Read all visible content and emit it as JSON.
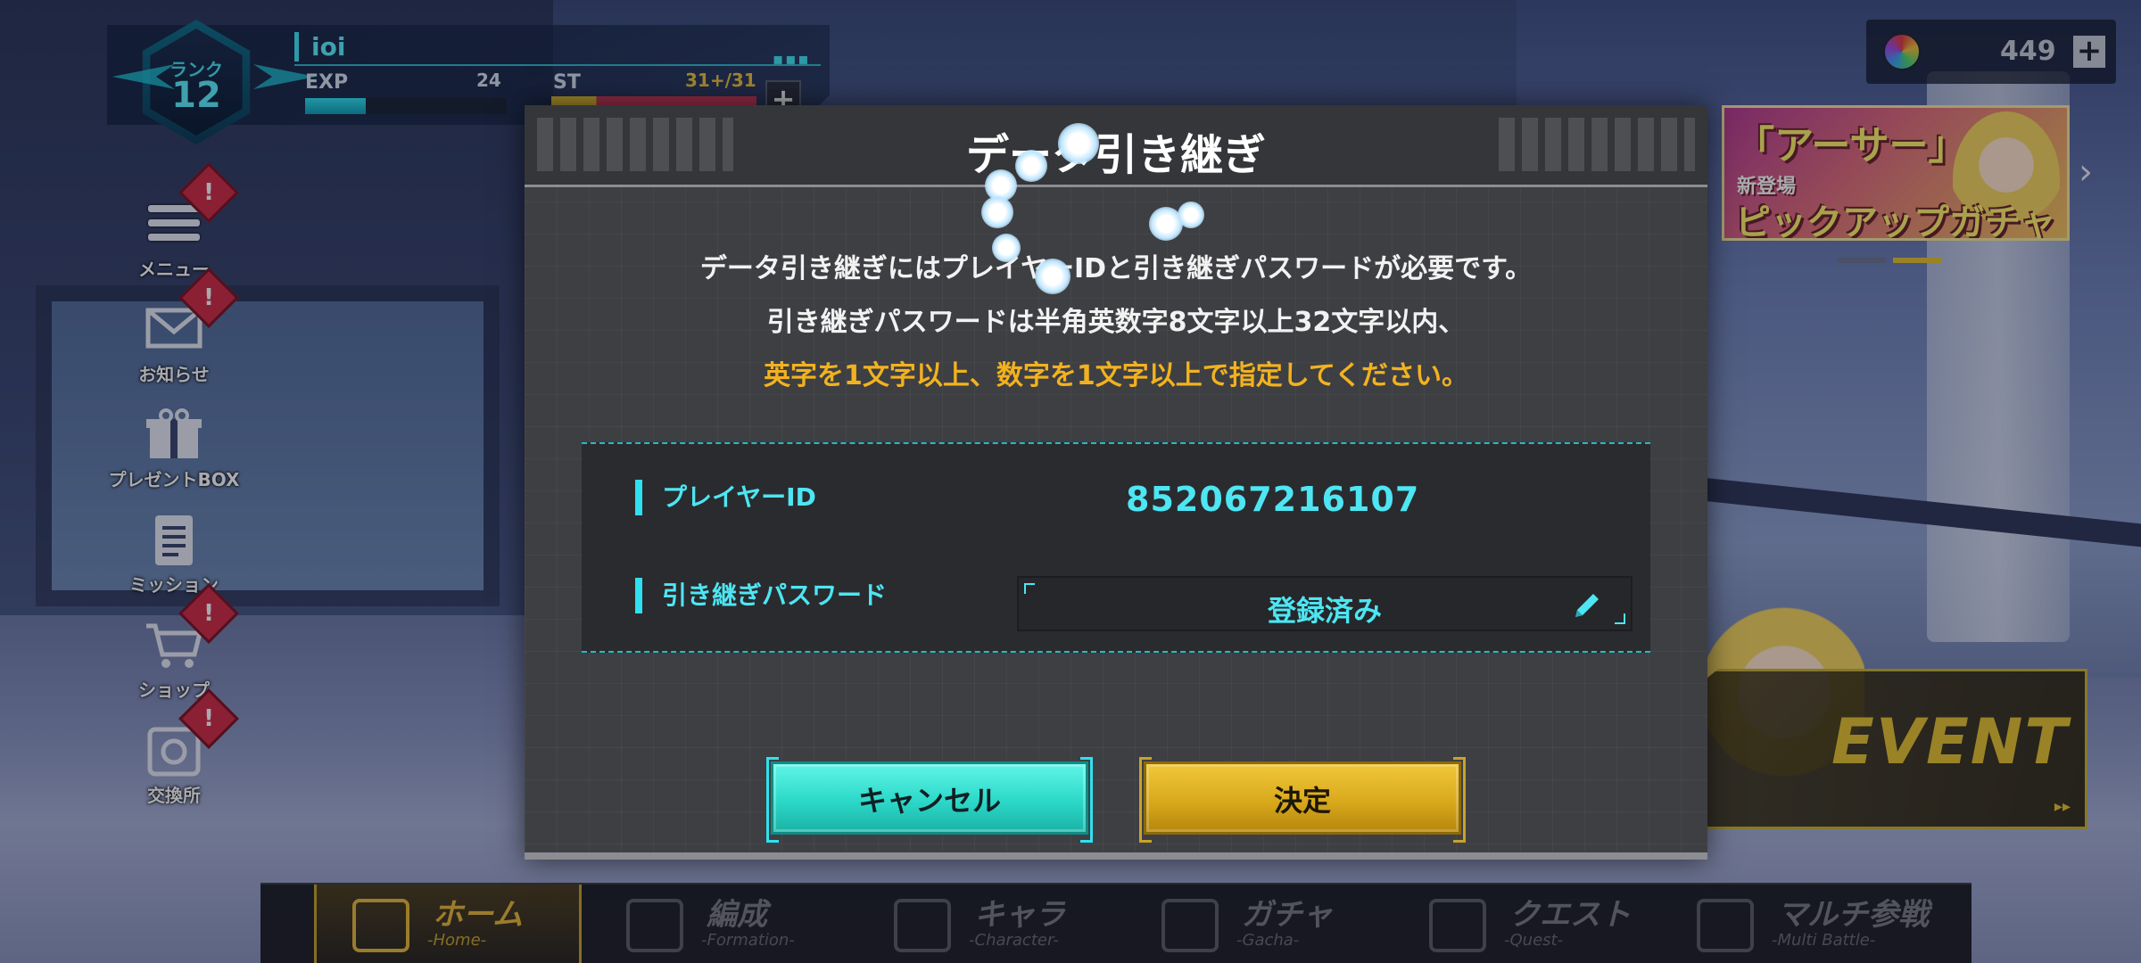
{
  "status": {
    "rank_label": "ランク",
    "rank_value": "12",
    "player_name": "ioi",
    "dots": "▪▪▪",
    "exp_label": "EXP",
    "exp_value": "24",
    "exp_progress": 0.3,
    "st_label": "ST",
    "st_value": "31+/31",
    "st_plus": "+"
  },
  "currency": {
    "count": "449",
    "plus": "+",
    "icon": "rainbow-gem-icon"
  },
  "side_menu": [
    {
      "label": "メニュー",
      "icon": "menu-icon",
      "alert": "!"
    },
    {
      "label": "お知らせ",
      "icon": "mail-icon",
      "alert": "!"
    },
    {
      "label": "プレゼントBOX",
      "icon": "gift-icon"
    },
    {
      "label": "ミッション",
      "icon": "clipboard-icon"
    },
    {
      "label": "ショップ",
      "icon": "cart-icon",
      "alert": "!"
    },
    {
      "label": "交換所",
      "icon": "exchange-icon",
      "alert": "!"
    }
  ],
  "banner": {
    "title": "「アーサー」",
    "new_label": "新登場",
    "subtitle": "ピックアップガチャ",
    "arrow": "›"
  },
  "event": {
    "label": "EVENT",
    "arrows": "▸▸"
  },
  "dialog": {
    "title": "データ引き継ぎ",
    "message_line1": "データ引き継ぎにはプレイヤーIDと引き継ぎパスワードが必要です。",
    "message_line2": "引き継ぎパスワードは半角英数字8文字以上32文字以内、",
    "message_line3": "英字を1文字以上、数字を1文字以上で指定してください。",
    "player_id_label": "プレイヤーID",
    "player_id_value": "852067216107",
    "password_label": "引き継ぎパスワード",
    "password_value": "登録済み",
    "cancel_label": "キャンセル",
    "ok_label": "決定"
  },
  "bottom_nav": [
    {
      "jp": "ホーム",
      "en": "-Home-",
      "icon": "home-emblem-icon",
      "active": true
    },
    {
      "jp": "編成",
      "en": "-Formation-",
      "icon": "formation-icon",
      "active": false
    },
    {
      "jp": "キャラ",
      "en": "-Character-",
      "icon": "character-icon",
      "active": false
    },
    {
      "jp": "ガチャ",
      "en": "-Gacha-",
      "icon": "gacha-chest-icon",
      "active": false
    },
    {
      "jp": "クエスト",
      "en": "-Quest-",
      "icon": "quest-ship-icon",
      "active": false
    },
    {
      "jp": "マルチ参戦",
      "en": "-Multi Battle-",
      "icon": "globe-icon",
      "active": false
    }
  ],
  "colors": {
    "accent_cyan": "#4de6f2",
    "accent_yellow": "#f2b21f",
    "alert_red": "#d12b46"
  }
}
